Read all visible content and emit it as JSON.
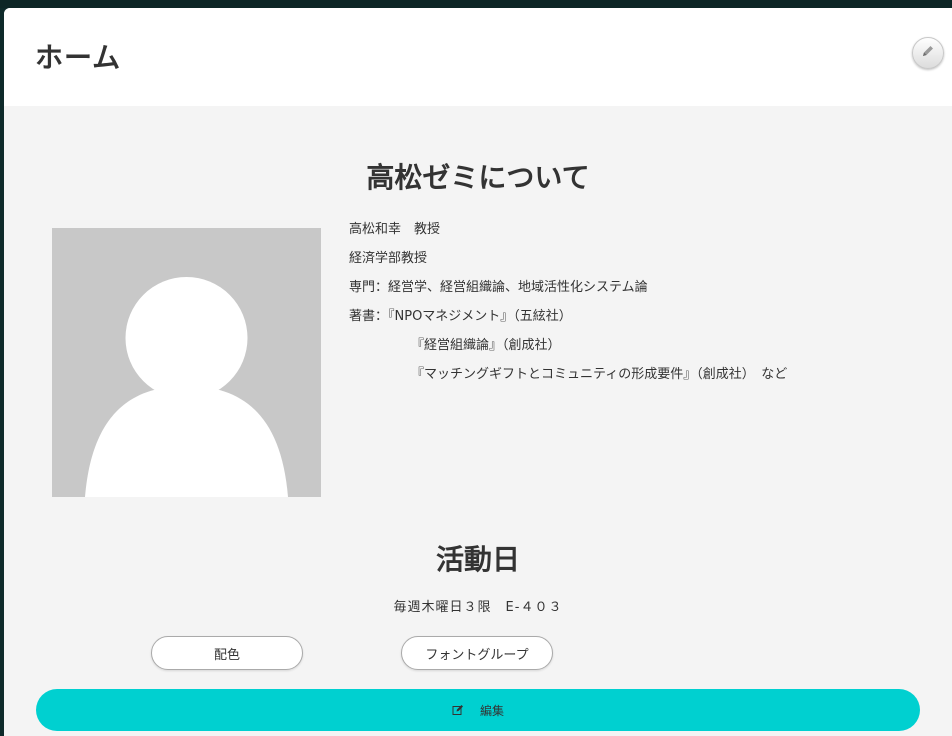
{
  "header": {
    "title": "ホーム",
    "edit_icon": "pencil-icon"
  },
  "about": {
    "heading": "高松ゼミについて",
    "photo_icon": "default-person-silhouette",
    "profile_lines": [
      "高松和幸　教授",
      "経済学部教授",
      "専門：経営学、経営組織論、地域活性化システム論",
      "著書：『NPOマネジメント』（五絃社）",
      "『経営組織論』（創成社）",
      "『マッチングギフトとコミュニティの形成要件』（創成社）　など"
    ]
  },
  "activity": {
    "heading": "活動日",
    "schedule": "毎週木曜日３限　E-４０３"
  },
  "buttons": {
    "color_scheme": "配色",
    "font_group": "フォントグループ",
    "edit": "編集",
    "edit_icon": "edit-square-icon"
  },
  "colors": {
    "accent": "#00d0d0",
    "panel_bg": "#f4f4f4",
    "header_bg": "#ffffff",
    "avatar_bg": "#c8c8c8"
  }
}
